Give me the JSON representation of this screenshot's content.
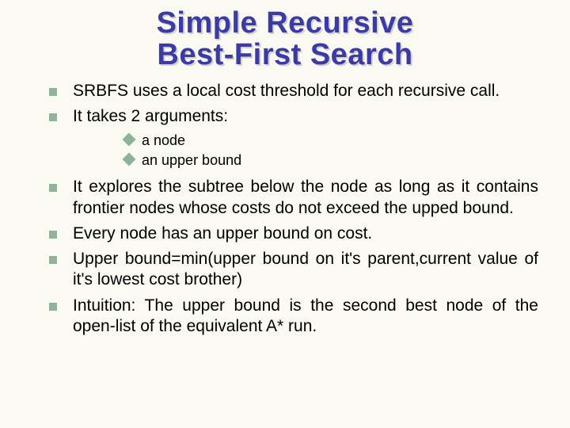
{
  "title": {
    "line1": "Simple Recursive",
    "line2": "Best-First Search"
  },
  "bullets": [
    "SRBFS uses a local cost threshold for each recursive call.",
    "It takes 2 arguments:"
  ],
  "subbullets": [
    "a node",
    "an upper bound"
  ],
  "bullets2": [
    "It explores  the subtree below the node as long as it contains frontier nodes whose costs do not exceed  the upped bound.",
    "Every node has an upper bound on cost.",
    "Upper bound=min(upper bound on it's parent,current value of it's lowest cost brother)",
    "Intuition: The upper bound is the second best node of the open-list of the equivalent A* run."
  ]
}
